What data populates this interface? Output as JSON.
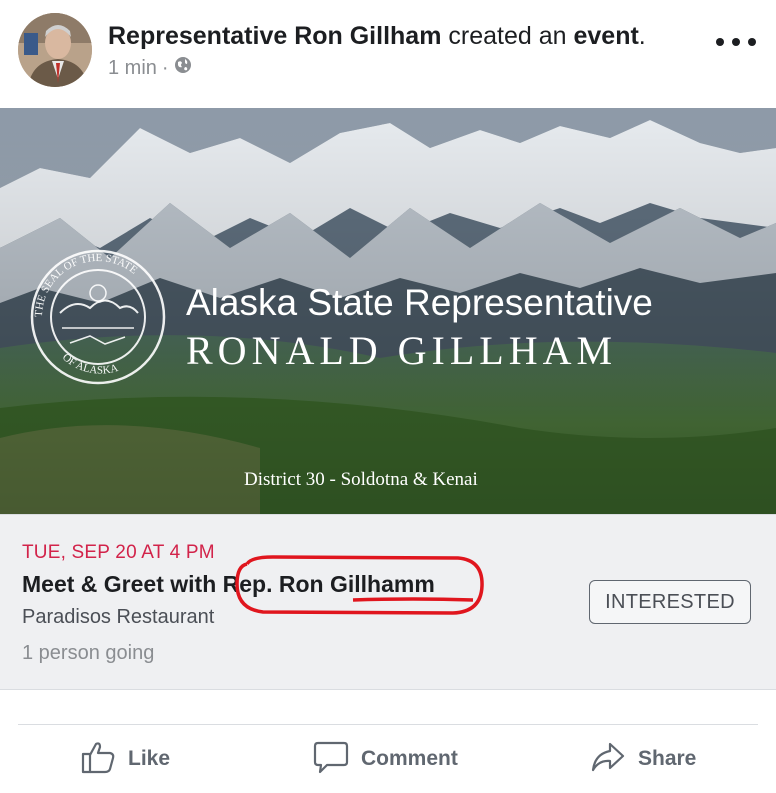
{
  "post": {
    "author": "Representative Ron Gillham",
    "action_prefix": "created an",
    "action_object": "event",
    "suffix": ".",
    "time": "1 min",
    "privacy_icon": "globe-icon",
    "more_icon": "more-dots-icon"
  },
  "banner": {
    "line1": "Alaska State Representative",
    "line2": "RONALD GILLHAM",
    "district": "District 30 - Soldotna & Kenai",
    "seal_top": "THE SEAL OF THE STATE",
    "seal_bottom": "OF ALASKA"
  },
  "event": {
    "date": "TUE, SEP 20 AT 4 PM",
    "title": "Meet & Greet with Rep. Ron Gillhamm",
    "venue": "Paradisos Restaurant",
    "going": "1 person going",
    "interested_label": "INTERESTED"
  },
  "actions": {
    "like": "Like",
    "comment": "Comment",
    "share": "Share"
  },
  "colors": {
    "date_red": "#d2234a",
    "annotation_red": "#e0161e"
  }
}
